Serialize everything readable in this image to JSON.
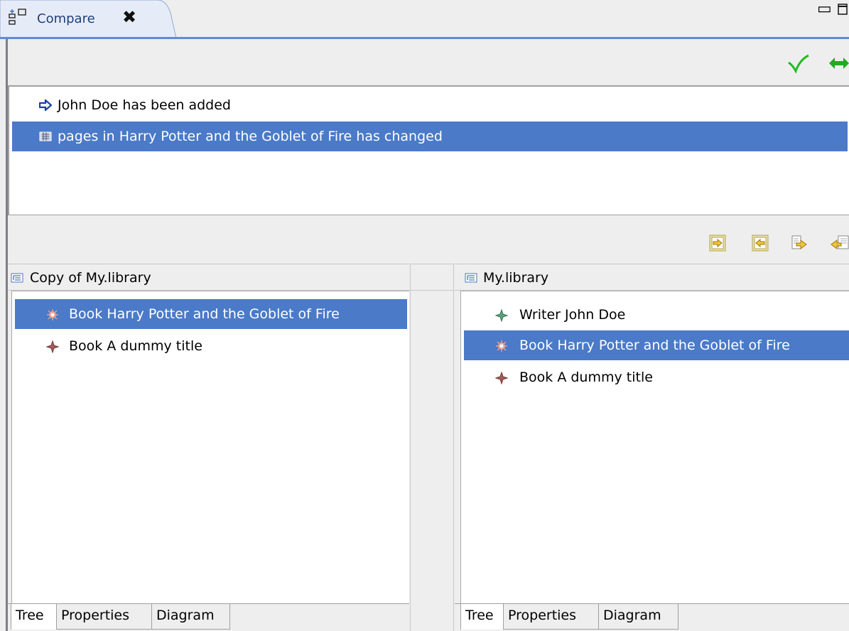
{
  "tab": {
    "title": "Compare"
  },
  "differences": [
    {
      "label": "John Doe has been added",
      "icon": "add-arrow-icon",
      "selected": false
    },
    {
      "label": "pages in Harry Potter and the Goblet of Fire has changed",
      "icon": "attribute-change-icon",
      "selected": true
    }
  ],
  "merge_toolbar": [
    "copy-all-to-right-icon",
    "copy-all-to-left-icon",
    "copy-current-to-right-icon",
    "copy-current-to-left-icon"
  ],
  "left_pane": {
    "title": "Copy of My.library",
    "items": [
      {
        "label": "Book Harry Potter and the Goblet of Fire",
        "selected": true
      },
      {
        "label": "Book A dummy title",
        "selected": false
      }
    ],
    "tabs": [
      "Tree",
      "Properties",
      "Diagram"
    ]
  },
  "right_pane": {
    "title": "My.library",
    "items": [
      {
        "label": "Writer John Doe",
        "selected": false
      },
      {
        "label": "Book Harry Potter and the Goblet of Fire",
        "selected": true
      },
      {
        "label": "Book A dummy title",
        "selected": false
      }
    ],
    "tabs": [
      "Tree",
      "Properties",
      "Diagram"
    ]
  },
  "colors": {
    "selection": "#4a7ac8",
    "accent_green": "#22bb22",
    "tab_border": "#5f8ad6"
  }
}
